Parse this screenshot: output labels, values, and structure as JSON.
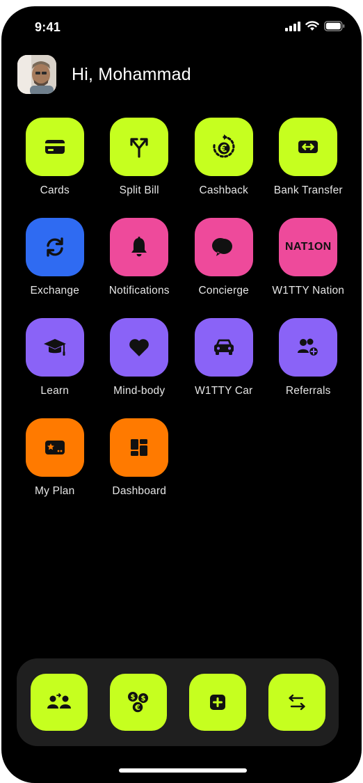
{
  "status_bar": {
    "time": "9:41"
  },
  "header": {
    "greeting": "Hi, Mohammad"
  },
  "colors": {
    "lime": "#c6ff1f",
    "blue": "#2f6bf2",
    "pink": "#ee4a9b",
    "purple": "#8a63f7",
    "orange": "#ff7a00",
    "background": "#000000",
    "dock": "#1f1f1f"
  },
  "apps": [
    {
      "label": "Cards",
      "icon": "card-icon",
      "color": "lime"
    },
    {
      "label": "Split Bill",
      "icon": "split-arrows-icon",
      "color": "lime"
    },
    {
      "label": "Cashback",
      "icon": "euro-cashback-icon",
      "color": "lime"
    },
    {
      "label": "Bank Transfer",
      "icon": "transfer-arrows-icon",
      "color": "lime"
    },
    {
      "label": "Exchange",
      "icon": "refresh-icon",
      "color": "blue"
    },
    {
      "label": "Notifications",
      "icon": "bell-icon",
      "color": "pink"
    },
    {
      "label": "Concierge",
      "icon": "chat-bubble-icon",
      "color": "pink"
    },
    {
      "label": "W1TTY Nation",
      "icon": "nation-wordmark",
      "icon_text": "NAT1ON",
      "color": "pink"
    },
    {
      "label": "Learn",
      "icon": "graduation-cap-icon",
      "color": "purple"
    },
    {
      "label": "Mind-body",
      "icon": "heart-icon",
      "color": "purple"
    },
    {
      "label": "W1TTY Car",
      "icon": "car-icon",
      "color": "purple"
    },
    {
      "label": "Referrals",
      "icon": "add-person-icon",
      "color": "purple"
    },
    {
      "label": "My Plan",
      "icon": "plan-star-icon",
      "color": "orange"
    },
    {
      "label": "Dashboard",
      "icon": "dashboard-icon",
      "color": "orange"
    }
  ],
  "dock": {
    "buttons": [
      {
        "icon": "send-to-contact-icon"
      },
      {
        "icon": "currency-exchange-icon"
      },
      {
        "icon": "add-icon"
      },
      {
        "icon": "swap-arrows-icon"
      }
    ]
  }
}
